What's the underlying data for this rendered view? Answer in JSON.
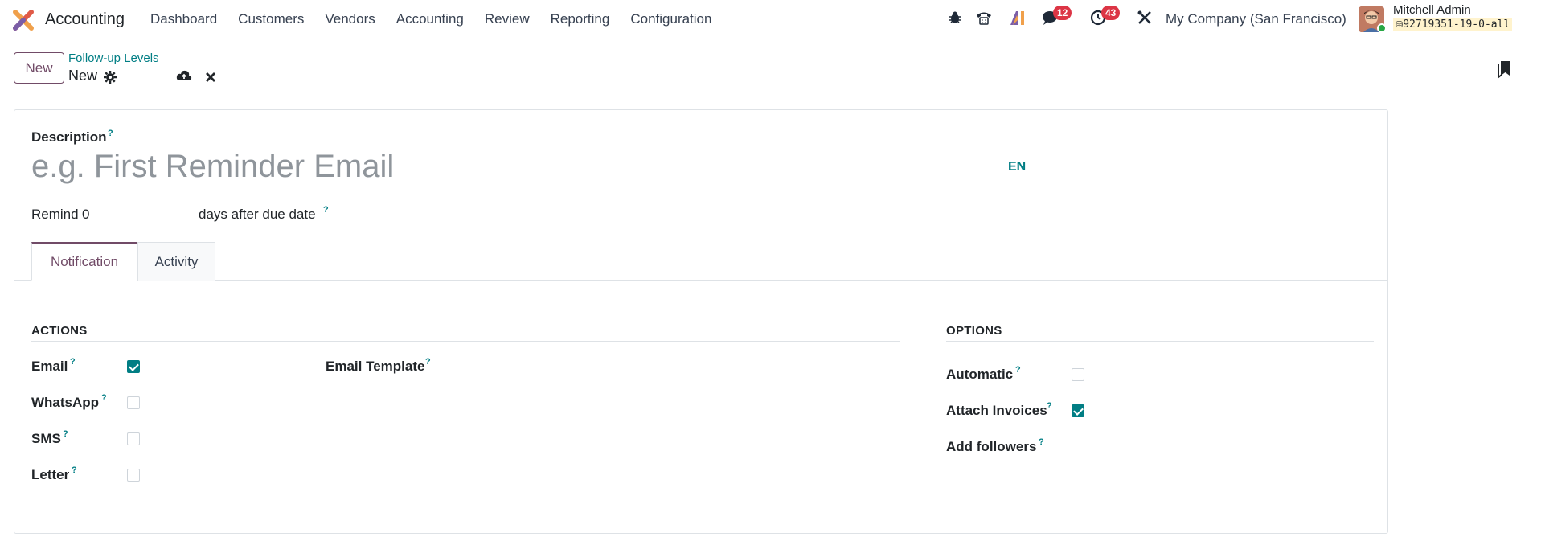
{
  "navbar": {
    "app_name": "Accounting",
    "menu": [
      "Dashboard",
      "Customers",
      "Vendors",
      "Accounting",
      "Review",
      "Reporting",
      "Configuration"
    ],
    "messages_count": "12",
    "activities_count": "43",
    "company": "My Company (San Francisco)",
    "user_name": "Mitchell Admin",
    "db_name": "92719351-19-0-all"
  },
  "control_panel": {
    "new_label": "New",
    "breadcrumb": "Follow-up Levels",
    "record_name": "New"
  },
  "form": {
    "description_label": "Description",
    "description_placeholder": "e.g. First Reminder Email",
    "lang": "EN",
    "remind_label": "Remind",
    "remind_value": "0",
    "days_label": "days after due date",
    "tabs": [
      "Notification",
      "Activity"
    ],
    "actions": {
      "title": "ACTIONS",
      "email": "Email",
      "whatsapp": "WhatsApp",
      "sms": "SMS",
      "letter": "Letter",
      "email_template": "Email Template",
      "email_checked": true,
      "whatsapp_checked": false,
      "sms_checked": false,
      "letter_checked": false
    },
    "options": {
      "title": "OPTIONS",
      "automatic": "Automatic",
      "attach_invoices": "Attach Invoices",
      "add_followers": "Add followers",
      "automatic_checked": false,
      "attach_invoices_checked": true
    },
    "help_mark": "?"
  },
  "colors": {
    "brand": "#714b67",
    "accent": "#017e84",
    "badge": "#dc3545"
  }
}
